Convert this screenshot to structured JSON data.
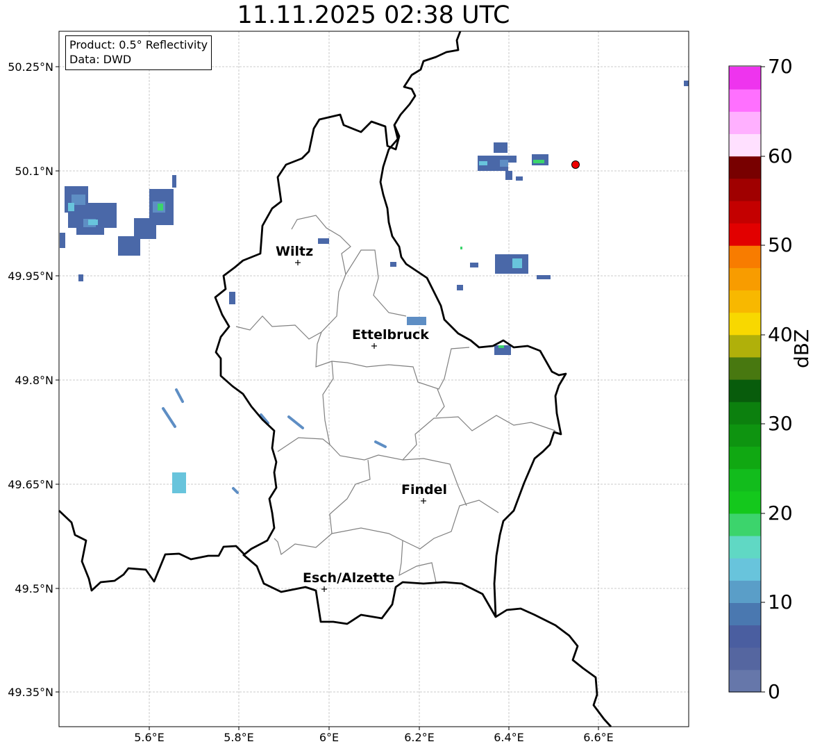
{
  "title": "11.11.2025 02:38 UTC",
  "info": {
    "product": "Product: 0.5° Reflectivity",
    "source": "Data: DWD"
  },
  "axes": {
    "x_ticks": [
      "5.6°E",
      "5.8°E",
      "6°E",
      "6.2°E",
      "6.4°E",
      "6.6°E"
    ],
    "y_ticks": [
      "50.25°N",
      "50.1°N",
      "49.95°N",
      "49.8°N",
      "49.65°N",
      "49.5°N",
      "49.35°N"
    ],
    "grid": true
  },
  "colorbar": {
    "label": "dBZ",
    "ticks": [
      "0",
      "10",
      "20",
      "30",
      "40",
      "50",
      "60",
      "70"
    ],
    "colors": [
      "#6677aa",
      "#5566a0",
      "#4a5ea0",
      "#4a78b0",
      "#5a9ec8",
      "#68c4dc",
      "#60d8c4",
      "#3cd46c",
      "#14c81c",
      "#12bc1c",
      "#10a812",
      "#0e9410",
      "#0c800e",
      "#085c0c",
      "#487810",
      "#b0b00a",
      "#f8d800",
      "#f8b800",
      "#f89c00",
      "#f87c00",
      "#e20000",
      "#c40000",
      "#a00000",
      "#780000",
      "#ffe0ff",
      "#ffb0ff",
      "#ff70ff",
      "#ee34ee"
    ]
  },
  "cities": [
    {
      "name": "Wiltz"
    },
    {
      "name": "Ettelbruck"
    },
    {
      "name": "Findel"
    },
    {
      "name": "Esch/Alzette"
    }
  ],
  "colors": {
    "border": "#000000",
    "cantons": "#808080",
    "marker": "#ee0000"
  }
}
